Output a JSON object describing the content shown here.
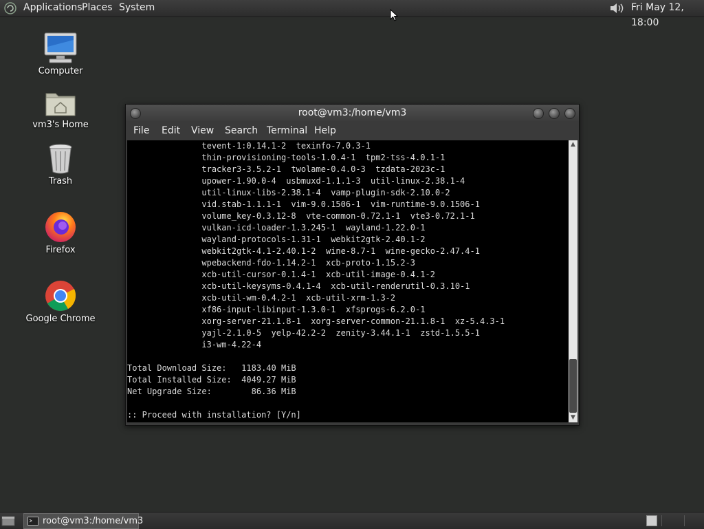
{
  "top_panel": {
    "menus": [
      "Applications",
      "Places",
      "System"
    ],
    "clock": "Fri May 12, 18:00",
    "icons": [
      "distro-logo-icon",
      "volume-icon"
    ]
  },
  "desktop": {
    "icons": [
      {
        "label": "Computer",
        "icon": "computer-icon"
      },
      {
        "label": "vm3's Home",
        "icon": "home-folder-icon"
      },
      {
        "label": "Trash",
        "icon": "trash-icon"
      },
      {
        "label": "Firefox",
        "icon": "firefox-icon"
      },
      {
        "label": "Google Chrome",
        "icon": "chrome-icon"
      }
    ]
  },
  "terminal": {
    "title": "root@vm3:/home/vm3",
    "menu": [
      "File",
      "Edit",
      "View",
      "Search",
      "Terminal",
      "Help"
    ],
    "lines": [
      "               tevent-1:0.14.1-2  texinfo-7.0.3-1",
      "               thin-provisioning-tools-1.0.4-1  tpm2-tss-4.0.1-1",
      "               tracker3-3.5.2-1  twolame-0.4.0-3  tzdata-2023c-1",
      "               upower-1.90.0-4  usbmuxd-1.1.1-3  util-linux-2.38.1-4",
      "               util-linux-libs-2.38.1-4  vamp-plugin-sdk-2.10.0-2",
      "               vid.stab-1.1.1-1  vim-9.0.1506-1  vim-runtime-9.0.1506-1",
      "               volume_key-0.3.12-8  vte-common-0.72.1-1  vte3-0.72.1-1",
      "               vulkan-icd-loader-1.3.245-1  wayland-1.22.0-1",
      "               wayland-protocols-1.31-1  webkit2gtk-2.40.1-2",
      "               webkit2gtk-4.1-2.40.1-2  wine-8.7-1  wine-gecko-2.47.4-1",
      "               wpebackend-fdo-1.14.2-1  xcb-proto-1.15.2-3",
      "               xcb-util-cursor-0.1.4-1  xcb-util-image-0.4.1-2",
      "               xcb-util-keysyms-0.4.1-4  xcb-util-renderutil-0.3.10-1",
      "               xcb-util-wm-0.4.2-1  xcb-util-xrm-1.3-2",
      "               xf86-input-libinput-1.3.0-1  xfsprogs-6.2.0-1",
      "               xorg-server-21.1.8-1  xorg-server-common-21.1.8-1  xz-5.4.3-1",
      "               yajl-2.1.0-5  yelp-42.2-2  zenity-3.44.1-1  zstd-1.5.5-1",
      "               i3-wm-4.22-4",
      "",
      "Total Download Size:   1183.40 MiB",
      "Total Installed Size:  4049.27 MiB",
      "Net Upgrade Size:        86.36 MiB",
      "",
      ":: Proceed with installation? [Y/n]"
    ]
  },
  "bottom_panel": {
    "task_label": "root@vm3:/home/vm3",
    "icons": [
      "show-desktop-icon",
      "terminal-icon"
    ]
  }
}
